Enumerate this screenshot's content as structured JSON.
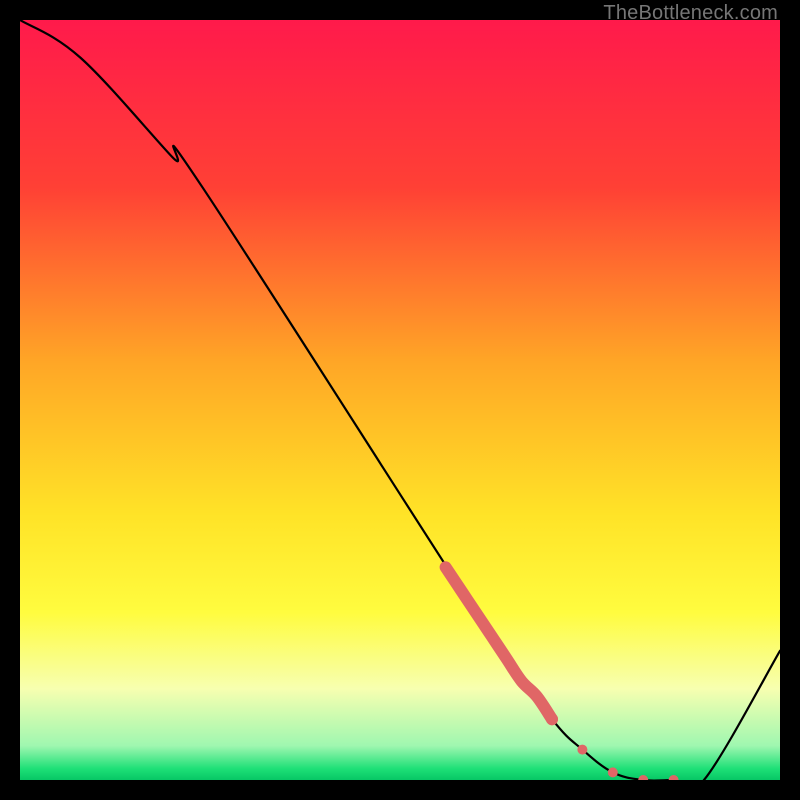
{
  "watermark": "TheBottleneck.com",
  "chart_data": {
    "type": "line",
    "title": "",
    "xlabel": "",
    "ylabel": "",
    "xlim": [
      0,
      100
    ],
    "ylim": [
      0,
      100
    ],
    "grid": false,
    "legend": false,
    "series": [
      {
        "name": "curve",
        "x": [
          0,
          8,
          20,
          24,
          62,
          70,
          74,
          78,
          82,
          86,
          90,
          100
        ],
        "values": [
          100,
          95,
          82,
          78,
          19,
          8,
          4,
          1,
          0,
          0,
          0,
          17
        ]
      }
    ],
    "dotted_segment": {
      "x": [
        70,
        74,
        78,
        82,
        86
      ],
      "values": [
        8,
        4,
        1,
        0,
        0
      ]
    },
    "highlight_segment": {
      "x": [
        56,
        58,
        60,
        62,
        64,
        66,
        68,
        70
      ],
      "values": [
        28,
        25,
        22,
        19,
        16,
        13,
        11,
        8
      ]
    },
    "background_gradient": {
      "stops": [
        {
          "offset": 0.0,
          "color": "#ff1a4b"
        },
        {
          "offset": 0.22,
          "color": "#ff4035"
        },
        {
          "offset": 0.45,
          "color": "#ffa626"
        },
        {
          "offset": 0.65,
          "color": "#ffe327"
        },
        {
          "offset": 0.78,
          "color": "#fffc3f"
        },
        {
          "offset": 0.88,
          "color": "#f7ffb0"
        },
        {
          "offset": 0.955,
          "color": "#9ff7b0"
        },
        {
          "offset": 0.985,
          "color": "#1ee077"
        },
        {
          "offset": 1.0,
          "color": "#07c765"
        }
      ]
    }
  }
}
